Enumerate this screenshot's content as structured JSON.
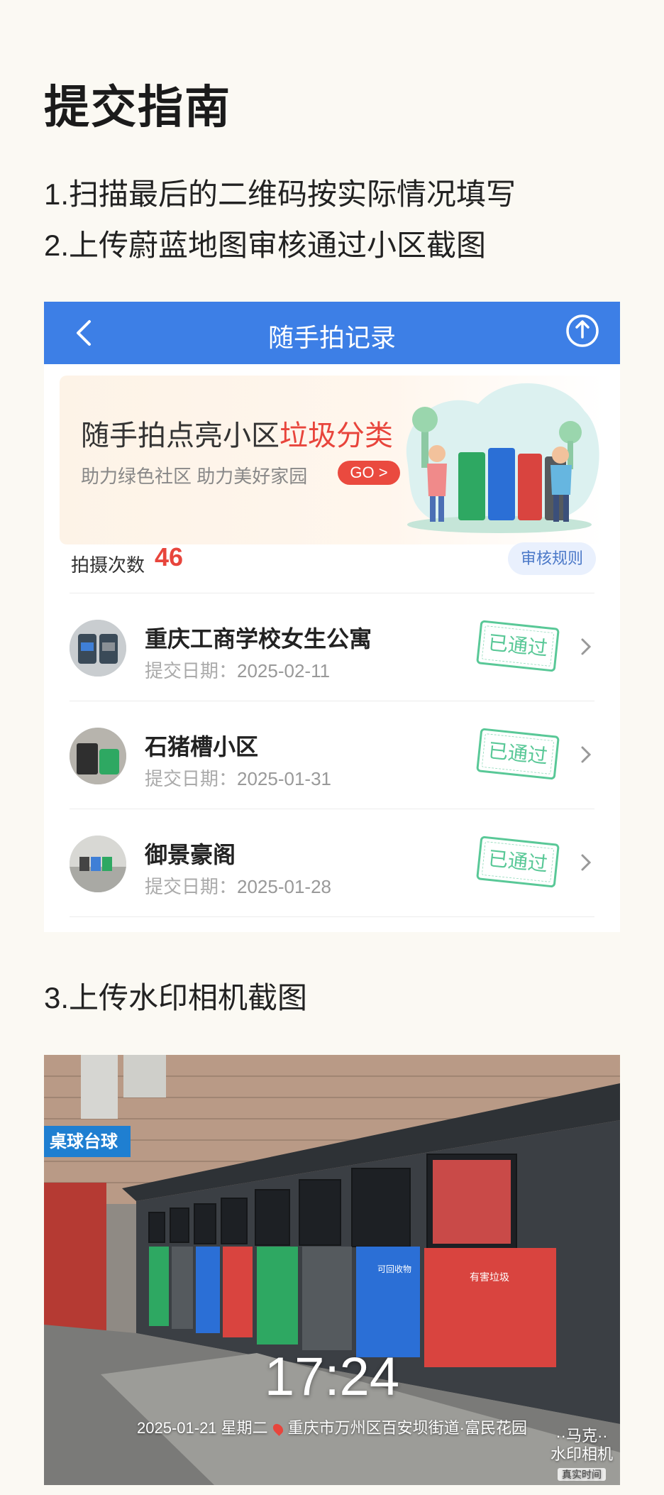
{
  "heading": "提交指南",
  "steps": {
    "s1": "1.扫描最后的二维码按实际情况填写",
    "s2": "2.上传蔚蓝地图审核通过小区截图",
    "s3": "3.上传水印相机截图"
  },
  "app": {
    "title": "随手拍记录",
    "banner": {
      "title_main": "随手拍点亮小区",
      "title_highlight": "垃圾分类",
      "subtitle": "助力绿色社区  助力美好家园",
      "go_label": "GO >"
    },
    "count_label": "拍摄次数",
    "count_value": "46",
    "rules_label": "审核规则",
    "date_label": "提交日期：",
    "records": [
      {
        "name": "重庆工商学校女生公寓",
        "date": "2025-02-11",
        "status": "已通过"
      },
      {
        "name": "石猪槽小区",
        "date": "2025-01-31",
        "status": "已通过"
      },
      {
        "name": "御景豪阁",
        "date": "2025-01-28",
        "status": "已通过"
      }
    ]
  },
  "photo": {
    "time": "17:24",
    "datetime": "2025-01-21 星期二",
    "location": "重庆市万州区百安坝街道·富民花园",
    "brand_top": "··马克··",
    "brand_name": "水印相机",
    "badge": "真实时间",
    "sign": "桌球台球",
    "bin_labels": [
      "有害垃圾",
      "可回收物"
    ]
  },
  "colors": {
    "navbar": "#3d7fe6",
    "accent_red": "#e8453c",
    "stamp_green": "#3dbf85",
    "bin_green": "#2ea862",
    "bin_blue": "#2b6fd6",
    "bin_red": "#d9443f",
    "bin_gray": "#555a5e"
  },
  "icons": [
    "back-arrow-icon",
    "share-upload-icon",
    "chevron-right-icon",
    "location-pin-icon"
  ]
}
